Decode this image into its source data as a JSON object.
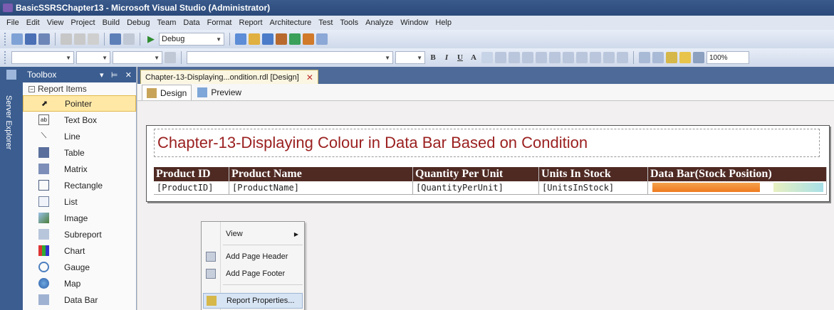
{
  "window": {
    "title": "BasicSSRSChapter13 - Microsoft Visual Studio (Administrator)"
  },
  "menu": [
    "File",
    "Edit",
    "View",
    "Project",
    "Build",
    "Debug",
    "Team",
    "Data",
    "Format",
    "Report",
    "Architecture",
    "Test",
    "Tools",
    "Analyze",
    "Window",
    "Help"
  ],
  "toolbar": {
    "config": "Debug",
    "zoom": "100%"
  },
  "server_explorer": {
    "label": "Server Explorer"
  },
  "toolbox": {
    "title": "Toolbox",
    "controls": [
      "▾",
      "$",
      "✕"
    ],
    "group": "Report Items",
    "items": [
      "Pointer",
      "Text Box",
      "Line",
      "Table",
      "Matrix",
      "Rectangle",
      "List",
      "Image",
      "Subreport",
      "Chart",
      "Gauge",
      "Map",
      "Data Bar"
    ]
  },
  "document": {
    "tab": "Chapter-13-Displaying...ondition.rdl [Design]",
    "close": "✕"
  },
  "designer_tabs": [
    "Design",
    "Preview"
  ],
  "report": {
    "title": "Chapter-13-Displaying Colour in Data Bar Based on Condition",
    "headers": [
      "Product ID",
      "Product Name",
      "Quantity Per Unit",
      "Units In Stock",
      "Data Bar(Stock Position)"
    ],
    "cells": [
      "[ProductID]",
      "[ProductName]",
      "[QuantityPerUnit]",
      "[UnitsInStock]"
    ],
    "databar_fill": 0.63,
    "databar_color": "#ef7a1e"
  },
  "context_menu": {
    "items": [
      "View",
      "Add Page Header",
      "Add Page Footer",
      "Report Properties..."
    ],
    "highlighted": "Report Properties..."
  },
  "colors": {
    "header_bg": "#4f2a23",
    "title_color": "#9b2020",
    "accent": "#3b5d90"
  }
}
